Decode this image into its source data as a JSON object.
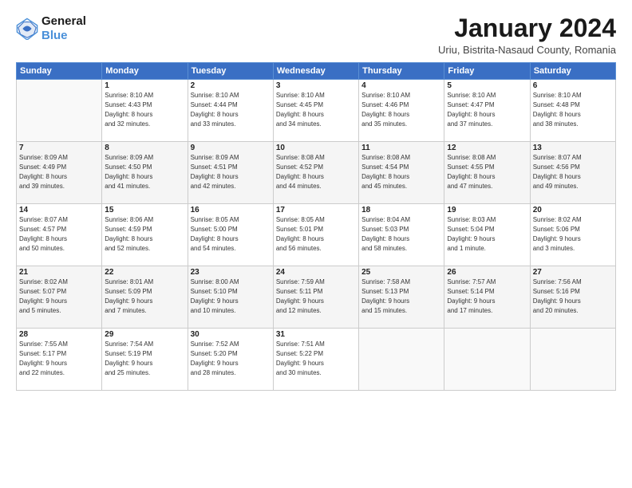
{
  "logo": {
    "line1": "General",
    "line2": "Blue"
  },
  "title": "January 2024",
  "location": "Uriu, Bistrita-Nasaud County, Romania",
  "days_of_week": [
    "Sunday",
    "Monday",
    "Tuesday",
    "Wednesday",
    "Thursday",
    "Friday",
    "Saturday"
  ],
  "weeks": [
    [
      {
        "day": "",
        "info": ""
      },
      {
        "day": "1",
        "info": "Sunrise: 8:10 AM\nSunset: 4:43 PM\nDaylight: 8 hours\nand 32 minutes."
      },
      {
        "day": "2",
        "info": "Sunrise: 8:10 AM\nSunset: 4:44 PM\nDaylight: 8 hours\nand 33 minutes."
      },
      {
        "day": "3",
        "info": "Sunrise: 8:10 AM\nSunset: 4:45 PM\nDaylight: 8 hours\nand 34 minutes."
      },
      {
        "day": "4",
        "info": "Sunrise: 8:10 AM\nSunset: 4:46 PM\nDaylight: 8 hours\nand 35 minutes."
      },
      {
        "day": "5",
        "info": "Sunrise: 8:10 AM\nSunset: 4:47 PM\nDaylight: 8 hours\nand 37 minutes."
      },
      {
        "day": "6",
        "info": "Sunrise: 8:10 AM\nSunset: 4:48 PM\nDaylight: 8 hours\nand 38 minutes."
      }
    ],
    [
      {
        "day": "7",
        "info": "Sunrise: 8:09 AM\nSunset: 4:49 PM\nDaylight: 8 hours\nand 39 minutes."
      },
      {
        "day": "8",
        "info": "Sunrise: 8:09 AM\nSunset: 4:50 PM\nDaylight: 8 hours\nand 41 minutes."
      },
      {
        "day": "9",
        "info": "Sunrise: 8:09 AM\nSunset: 4:51 PM\nDaylight: 8 hours\nand 42 minutes."
      },
      {
        "day": "10",
        "info": "Sunrise: 8:08 AM\nSunset: 4:52 PM\nDaylight: 8 hours\nand 44 minutes."
      },
      {
        "day": "11",
        "info": "Sunrise: 8:08 AM\nSunset: 4:54 PM\nDaylight: 8 hours\nand 45 minutes."
      },
      {
        "day": "12",
        "info": "Sunrise: 8:08 AM\nSunset: 4:55 PM\nDaylight: 8 hours\nand 47 minutes."
      },
      {
        "day": "13",
        "info": "Sunrise: 8:07 AM\nSunset: 4:56 PM\nDaylight: 8 hours\nand 49 minutes."
      }
    ],
    [
      {
        "day": "14",
        "info": "Sunrise: 8:07 AM\nSunset: 4:57 PM\nDaylight: 8 hours\nand 50 minutes."
      },
      {
        "day": "15",
        "info": "Sunrise: 8:06 AM\nSunset: 4:59 PM\nDaylight: 8 hours\nand 52 minutes."
      },
      {
        "day": "16",
        "info": "Sunrise: 8:05 AM\nSunset: 5:00 PM\nDaylight: 8 hours\nand 54 minutes."
      },
      {
        "day": "17",
        "info": "Sunrise: 8:05 AM\nSunset: 5:01 PM\nDaylight: 8 hours\nand 56 minutes."
      },
      {
        "day": "18",
        "info": "Sunrise: 8:04 AM\nSunset: 5:03 PM\nDaylight: 8 hours\nand 58 minutes."
      },
      {
        "day": "19",
        "info": "Sunrise: 8:03 AM\nSunset: 5:04 PM\nDaylight: 9 hours\nand 1 minute."
      },
      {
        "day": "20",
        "info": "Sunrise: 8:02 AM\nSunset: 5:06 PM\nDaylight: 9 hours\nand 3 minutes."
      }
    ],
    [
      {
        "day": "21",
        "info": "Sunrise: 8:02 AM\nSunset: 5:07 PM\nDaylight: 9 hours\nand 5 minutes."
      },
      {
        "day": "22",
        "info": "Sunrise: 8:01 AM\nSunset: 5:09 PM\nDaylight: 9 hours\nand 7 minutes."
      },
      {
        "day": "23",
        "info": "Sunrise: 8:00 AM\nSunset: 5:10 PM\nDaylight: 9 hours\nand 10 minutes."
      },
      {
        "day": "24",
        "info": "Sunrise: 7:59 AM\nSunset: 5:11 PM\nDaylight: 9 hours\nand 12 minutes."
      },
      {
        "day": "25",
        "info": "Sunrise: 7:58 AM\nSunset: 5:13 PM\nDaylight: 9 hours\nand 15 minutes."
      },
      {
        "day": "26",
        "info": "Sunrise: 7:57 AM\nSunset: 5:14 PM\nDaylight: 9 hours\nand 17 minutes."
      },
      {
        "day": "27",
        "info": "Sunrise: 7:56 AM\nSunset: 5:16 PM\nDaylight: 9 hours\nand 20 minutes."
      }
    ],
    [
      {
        "day": "28",
        "info": "Sunrise: 7:55 AM\nSunset: 5:17 PM\nDaylight: 9 hours\nand 22 minutes."
      },
      {
        "day": "29",
        "info": "Sunrise: 7:54 AM\nSunset: 5:19 PM\nDaylight: 9 hours\nand 25 minutes."
      },
      {
        "day": "30",
        "info": "Sunrise: 7:52 AM\nSunset: 5:20 PM\nDaylight: 9 hours\nand 28 minutes."
      },
      {
        "day": "31",
        "info": "Sunrise: 7:51 AM\nSunset: 5:22 PM\nDaylight: 9 hours\nand 30 minutes."
      },
      {
        "day": "",
        "info": ""
      },
      {
        "day": "",
        "info": ""
      },
      {
        "day": "",
        "info": ""
      }
    ]
  ]
}
